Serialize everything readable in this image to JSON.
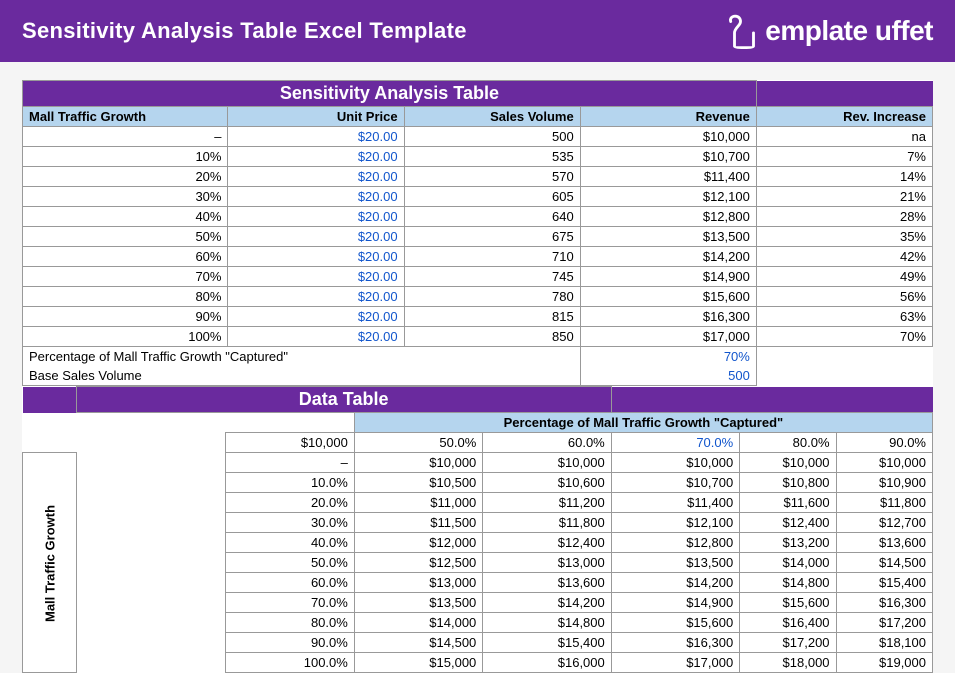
{
  "banner": {
    "title": "Sensitivity Analysis Table Excel Template",
    "logo_text": "emplate uffet"
  },
  "sat": {
    "title": "Sensitivity Analysis Table",
    "headers": [
      "Mall Traffic Growth",
      "Unit Price",
      "Sales Volume",
      "Revenue",
      "Rev. Increase"
    ],
    "rows": [
      {
        "growth": "–",
        "price": "$20.00",
        "vol": "500",
        "rev": "$10,000",
        "inc": "na"
      },
      {
        "growth": "10%",
        "price": "$20.00",
        "vol": "535",
        "rev": "$10,700",
        "inc": "7%"
      },
      {
        "growth": "20%",
        "price": "$20.00",
        "vol": "570",
        "rev": "$11,400",
        "inc": "14%"
      },
      {
        "growth": "30%",
        "price": "$20.00",
        "vol": "605",
        "rev": "$12,100",
        "inc": "21%"
      },
      {
        "growth": "40%",
        "price": "$20.00",
        "vol": "640",
        "rev": "$12,800",
        "inc": "28%"
      },
      {
        "growth": "50%",
        "price": "$20.00",
        "vol": "675",
        "rev": "$13,500",
        "inc": "35%"
      },
      {
        "growth": "60%",
        "price": "$20.00",
        "vol": "710",
        "rev": "$14,200",
        "inc": "42%"
      },
      {
        "growth": "70%",
        "price": "$20.00",
        "vol": "745",
        "rev": "$14,900",
        "inc": "49%"
      },
      {
        "growth": "80%",
        "price": "$20.00",
        "vol": "780",
        "rev": "$15,600",
        "inc": "56%"
      },
      {
        "growth": "90%",
        "price": "$20.00",
        "vol": "815",
        "rev": "$16,300",
        "inc": "63%"
      },
      {
        "growth": "100%",
        "price": "$20.00",
        "vol": "850",
        "rev": "$17,000",
        "inc": "70%"
      }
    ],
    "note1_label": "Percentage of Mall Traffic Growth \"Captured\"",
    "note1_value": "70%",
    "note2_label": "Base Sales Volume",
    "note2_value": "500"
  },
  "dt": {
    "title": "Data Table",
    "top_label": "Percentage of Mall Traffic Growth \"Captured\"",
    "side_label": "Mall Traffic Growth",
    "corner": "$10,000",
    "col_pcts": [
      "50.0%",
      "60.0%",
      "70.0%",
      "80.0%",
      "90.0%"
    ],
    "highlight_col_index": 2,
    "rows": [
      {
        "g": "–",
        "v": [
          "$10,000",
          "$10,000",
          "$10,000",
          "$10,000",
          "$10,000"
        ]
      },
      {
        "g": "10.0%",
        "v": [
          "$10,500",
          "$10,600",
          "$10,700",
          "$10,800",
          "$10,900"
        ]
      },
      {
        "g": "20.0%",
        "v": [
          "$11,000",
          "$11,200",
          "$11,400",
          "$11,600",
          "$11,800"
        ]
      },
      {
        "g": "30.0%",
        "v": [
          "$11,500",
          "$11,800",
          "$12,100",
          "$12,400",
          "$12,700"
        ]
      },
      {
        "g": "40.0%",
        "v": [
          "$12,000",
          "$12,400",
          "$12,800",
          "$13,200",
          "$13,600"
        ]
      },
      {
        "g": "50.0%",
        "v": [
          "$12,500",
          "$13,000",
          "$13,500",
          "$14,000",
          "$14,500"
        ]
      },
      {
        "g": "60.0%",
        "v": [
          "$13,000",
          "$13,600",
          "$14,200",
          "$14,800",
          "$15,400"
        ]
      },
      {
        "g": "70.0%",
        "v": [
          "$13,500",
          "$14,200",
          "$14,900",
          "$15,600",
          "$16,300"
        ]
      },
      {
        "g": "80.0%",
        "v": [
          "$14,000",
          "$14,800",
          "$15,600",
          "$16,400",
          "$17,200"
        ]
      },
      {
        "g": "90.0%",
        "v": [
          "$14,500",
          "$15,400",
          "$16,300",
          "$17,200",
          "$18,100"
        ]
      },
      {
        "g": "100.0%",
        "v": [
          "$15,000",
          "$16,000",
          "$17,000",
          "$18,000",
          "$19,000"
        ]
      }
    ]
  },
  "chart_data": {
    "type": "table",
    "title": "Sensitivity Analysis & Data Table",
    "sensitivity": {
      "unit_price": 20.0,
      "base_sales_volume": 500,
      "capture_pct": 0.7,
      "series": [
        {
          "growth_pct": 0,
          "sales_volume": 500,
          "revenue": 10000,
          "rev_increase_pct": null
        },
        {
          "growth_pct": 10,
          "sales_volume": 535,
          "revenue": 10700,
          "rev_increase_pct": 7
        },
        {
          "growth_pct": 20,
          "sales_volume": 570,
          "revenue": 11400,
          "rev_increase_pct": 14
        },
        {
          "growth_pct": 30,
          "sales_volume": 605,
          "revenue": 12100,
          "rev_increase_pct": 21
        },
        {
          "growth_pct": 40,
          "sales_volume": 640,
          "revenue": 12800,
          "rev_increase_pct": 28
        },
        {
          "growth_pct": 50,
          "sales_volume": 675,
          "revenue": 13500,
          "rev_increase_pct": 35
        },
        {
          "growth_pct": 60,
          "sales_volume": 710,
          "revenue": 14200,
          "rev_increase_pct": 42
        },
        {
          "growth_pct": 70,
          "sales_volume": 745,
          "revenue": 14900,
          "rev_increase_pct": 49
        },
        {
          "growth_pct": 80,
          "sales_volume": 780,
          "revenue": 15600,
          "rev_increase_pct": 56
        },
        {
          "growth_pct": 90,
          "sales_volume": 815,
          "revenue": 16300,
          "rev_increase_pct": 63
        },
        {
          "growth_pct": 100,
          "sales_volume": 850,
          "revenue": 17000,
          "rev_increase_pct": 70
        }
      ]
    },
    "data_table": {
      "x_label": "Percentage of Mall Traffic Growth Captured",
      "y_label": "Mall Traffic Growth",
      "x_pct": [
        50,
        60,
        70,
        80,
        90
      ],
      "y_pct": [
        0,
        10,
        20,
        30,
        40,
        50,
        60,
        70,
        80,
        90,
        100
      ],
      "revenue": [
        [
          10000,
          10000,
          10000,
          10000,
          10000
        ],
        [
          10500,
          10600,
          10700,
          10800,
          10900
        ],
        [
          11000,
          11200,
          11400,
          11600,
          11800
        ],
        [
          11500,
          11800,
          12100,
          12400,
          12700
        ],
        [
          12000,
          12400,
          12800,
          13200,
          13600
        ],
        [
          12500,
          13000,
          13500,
          14000,
          14500
        ],
        [
          13000,
          13600,
          14200,
          14800,
          15400
        ],
        [
          13500,
          14200,
          14900,
          15600,
          16300
        ],
        [
          14000,
          14800,
          15600,
          16400,
          17200
        ],
        [
          14500,
          15400,
          16300,
          17200,
          18100
        ],
        [
          15000,
          16000,
          17000,
          18000,
          19000
        ]
      ]
    }
  }
}
